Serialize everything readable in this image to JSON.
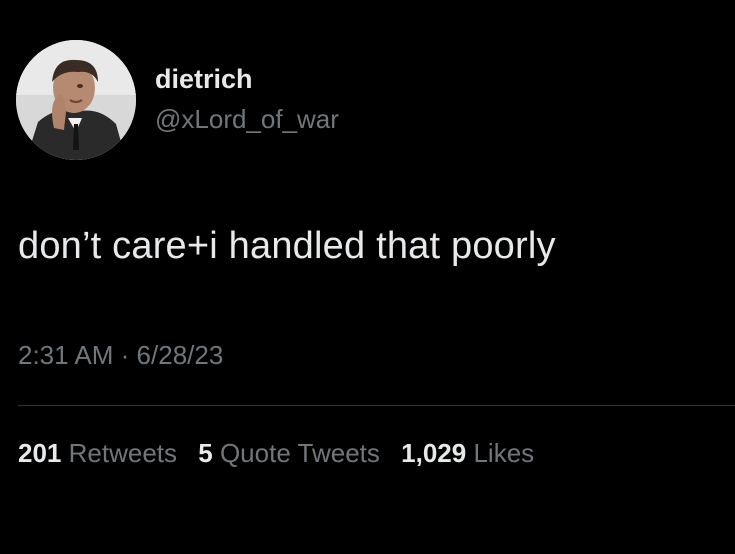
{
  "tweet": {
    "display_name": "dietrich",
    "handle": "@xLord_of_war",
    "text": "don’t care+i handled that poorly",
    "time": "2:31 AM",
    "separator": "·",
    "date": "6/28/23"
  },
  "stats": [
    {
      "count": "201",
      "label": "Retweets"
    },
    {
      "count": "5",
      "label": "Quote Tweets"
    },
    {
      "count": "1,029",
      "label": "Likes"
    }
  ],
  "colors": {
    "background": "#000000",
    "primary_text": "#e7e9ea",
    "secondary_text": "#71767b",
    "divider": "#2f3336"
  },
  "icons": {
    "avatar": "profile-photo"
  }
}
